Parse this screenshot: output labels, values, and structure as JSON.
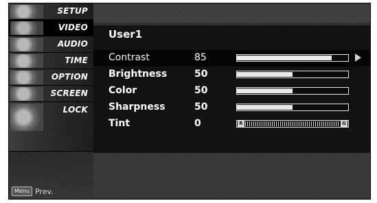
{
  "sidebar": {
    "items": [
      {
        "label": "SETUP"
      },
      {
        "label": "VIDEO"
      },
      {
        "label": "AUDIO"
      },
      {
        "label": "TIME"
      },
      {
        "label": "OPTION"
      },
      {
        "label": "SCREEN"
      },
      {
        "label": "LOCK"
      }
    ],
    "active_index": 1,
    "prev_key": "Menu",
    "prev_label": "Prev."
  },
  "panel": {
    "title": "User1",
    "rows": [
      {
        "label": "Contrast",
        "value": "85",
        "level": 0.85,
        "selected": true
      },
      {
        "label": "Brightness",
        "value": "50",
        "level": 0.5
      },
      {
        "label": "Color",
        "value": "50",
        "level": 0.5
      },
      {
        "label": "Sharpness",
        "value": "50",
        "level": 0.5
      },
      {
        "label": "Tint",
        "value": "0",
        "tint_left": "R",
        "tint_right": "G"
      }
    ]
  }
}
